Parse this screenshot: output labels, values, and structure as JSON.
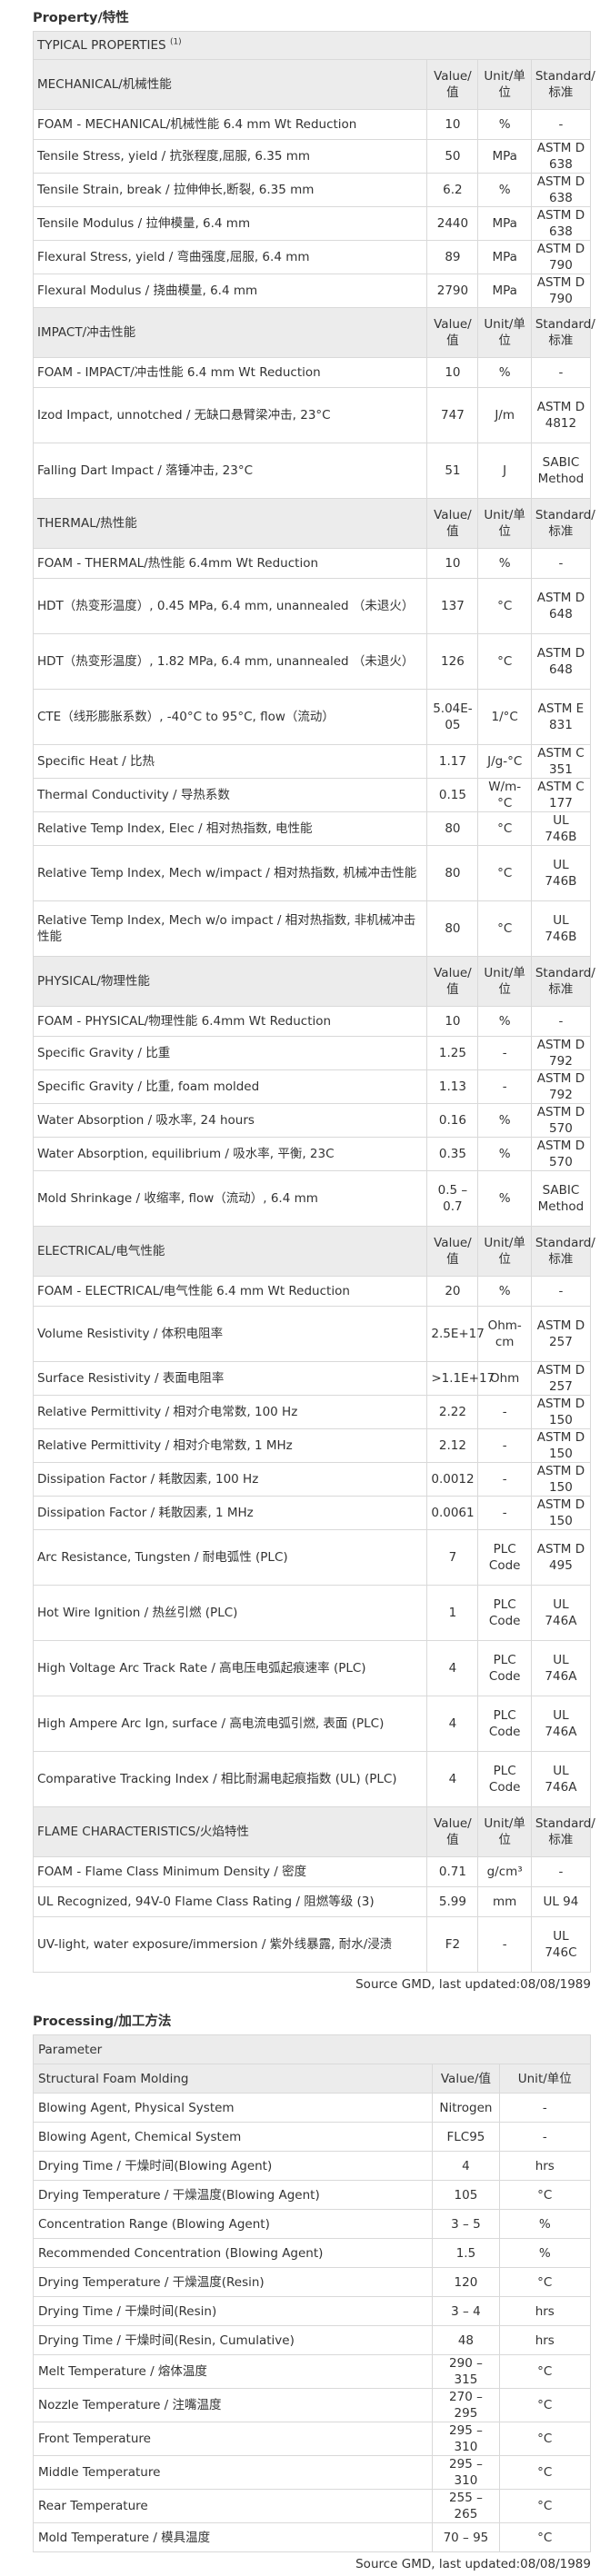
{
  "property": {
    "title": "Property/特性",
    "typical_header": "TYPICAL PROPERTIES",
    "typical_sup": "(1)",
    "col_value": "Value/值",
    "col_unit": "Unit/单位",
    "col_standard": "Standard/标准",
    "groups": [
      {
        "name": "MECHANICAL/机械性能",
        "rows": [
          {
            "name": "FOAM - MECHANICAL/机械性能 6.4 mm Wt Reduction",
            "value": "10",
            "unit": "%",
            "standard": "-"
          },
          {
            "name": "Tensile Stress, yield / 抗张程度,屈服, 6.35 mm",
            "value": "50",
            "unit": "MPa",
            "standard": "ASTM D 638"
          },
          {
            "name": "Tensile Strain, break / 拉伸伸长,断裂, 6.35 mm",
            "value": "6.2",
            "unit": "%",
            "standard": "ASTM D 638"
          },
          {
            "name": "Tensile Modulus / 拉伸模量, 6.4 mm",
            "value": "2440",
            "unit": "MPa",
            "standard": "ASTM D 638"
          },
          {
            "name": "Flexural Stress, yield / 弯曲强度,屈服, 6.4 mm",
            "value": "89",
            "unit": "MPa",
            "standard": "ASTM D 790"
          },
          {
            "name": "Flexural Modulus / 挠曲模量, 6.4 mm",
            "value": "2790",
            "unit": "MPa",
            "standard": "ASTM D 790"
          }
        ]
      },
      {
        "name": "IMPACT/冲击性能",
        "rows": [
          {
            "name": "FOAM - IMPACT/冲击性能 6.4 mm Wt Reduction",
            "value": "10",
            "unit": "%",
            "standard": "-"
          },
          {
            "name": "Izod Impact, unnotched / 无缺口悬臂梁冲击, 23°C",
            "value": "747",
            "unit": "J/m",
            "standard": "ASTM D 4812",
            "tall": true
          },
          {
            "name": "Falling Dart Impact / 落锤冲击, 23°C",
            "value": "51",
            "unit": "J",
            "standard": "SABIC Method",
            "tall": true
          }
        ]
      },
      {
        "name": "THERMAL/热性能",
        "rows": [
          {
            "name": "FOAM - THERMAL/热性能 6.4mm Wt Reduction",
            "value": "10",
            "unit": "%",
            "standard": "-"
          },
          {
            "name": "HDT（热变形温度）, 0.45 MPa, 6.4 mm, unannealed （未退火）",
            "value": "137",
            "unit": "°C",
            "standard": "ASTM D 648",
            "tall": true
          },
          {
            "name": "HDT（热变形温度）, 1.82 MPa, 6.4 mm, unannealed （未退火）",
            "value": "126",
            "unit": "°C",
            "standard": "ASTM D 648",
            "tall": true
          },
          {
            "name": "CTE（线形膨胀系数）, -40°C to 95°C, flow（流动）",
            "value": "5.04E-05",
            "unit": "1/°C",
            "standard": "ASTM E 831",
            "tall": true
          },
          {
            "name": "Specific Heat / 比热",
            "value": "1.17",
            "unit": "J/g-°C",
            "standard": "ASTM C 351"
          },
          {
            "name": "Thermal Conductivity / 导热系数",
            "value": "0.15",
            "unit": "W/m-°C",
            "standard": "ASTM C 177"
          },
          {
            "name": "Relative Temp Index, Elec / 相对热指数, 电性能",
            "value": "80",
            "unit": "°C",
            "standard": "UL 746B"
          },
          {
            "name": "Relative Temp Index, Mech w/impact / 相对热指数, 机械冲击性能",
            "value": "80",
            "unit": "°C",
            "standard": "UL 746B",
            "tall": true
          },
          {
            "name": "Relative Temp Index, Mech w/o impact / 相对热指数, 非机械冲击性能",
            "value": "80",
            "unit": "°C",
            "standard": "UL 746B",
            "tall": true
          }
        ]
      },
      {
        "name": "PHYSICAL/物理性能",
        "rows": [
          {
            "name": "FOAM - PHYSICAL/物理性能 6.4mm Wt Reduction",
            "value": "10",
            "unit": "%",
            "standard": "-"
          },
          {
            "name": "Specific Gravity / 比重",
            "value": "1.25",
            "unit": "-",
            "standard": "ASTM D 792"
          },
          {
            "name": "Specific Gravity / 比重, foam molded",
            "value": "1.13",
            "unit": "-",
            "standard": "ASTM D 792"
          },
          {
            "name": "Water Absorption / 吸水率, 24 hours",
            "value": "0.16",
            "unit": "%",
            "standard": "ASTM D 570"
          },
          {
            "name": "Water Absorption, equilibrium / 吸水率, 平衡, 23C",
            "value": "0.35",
            "unit": "%",
            "standard": "ASTM D 570"
          },
          {
            "name": "Mold Shrinkage / 收缩率, flow（流动）, 6.4 mm",
            "value": "0.5 – 0.7",
            "unit": "%",
            "standard": "SABIC Method",
            "tall": true
          }
        ]
      },
      {
        "name": "ELECTRICAL/电气性能",
        "rows": [
          {
            "name": "FOAM - ELECTRICAL/电气性能 6.4 mm Wt Reduction",
            "value": "20",
            "unit": "%",
            "standard": "-"
          },
          {
            "name": "Volume Resistivity / 体积电阻率",
            "value": "2.5E+17",
            "unit": "Ohm-cm",
            "standard": "ASTM D 257",
            "tall": true
          },
          {
            "name": "Surface Resistivity / 表面电阻率",
            "value": ">1.1E+17",
            "unit": "Ohm",
            "standard": "ASTM D 257"
          },
          {
            "name": "Relative Permittivity / 相对介电常数, 100 Hz",
            "value": "2.22",
            "unit": "-",
            "standard": "ASTM D 150"
          },
          {
            "name": "Relative Permittivity / 相对介电常数, 1 MHz",
            "value": "2.12",
            "unit": "-",
            "standard": "ASTM D 150"
          },
          {
            "name": "Dissipation Factor / 耗散因素, 100 Hz",
            "value": "0.0012",
            "unit": "-",
            "standard": "ASTM D 150"
          },
          {
            "name": "Dissipation Factor / 耗散因素, 1 MHz",
            "value": "0.0061",
            "unit": "-",
            "standard": "ASTM D 150"
          },
          {
            "name": "Arc Resistance, Tungsten / 耐电弧性 (PLC)",
            "value": "7",
            "unit": "PLC Code",
            "standard": "ASTM D 495",
            "tall": true
          },
          {
            "name": "Hot Wire Ignition / 热丝引燃 (PLC)",
            "value": "1",
            "unit": "PLC Code",
            "standard": "UL 746A",
            "tall": true
          },
          {
            "name": "High Voltage Arc Track Rate / 高电压电弧起痕速率 (PLC)",
            "value": "4",
            "unit": "PLC Code",
            "standard": "UL 746A",
            "tall": true
          },
          {
            "name": "High Ampere Arc Ign, surface / 高电流电弧引燃, 表面 (PLC)",
            "value": "4",
            "unit": "PLC Code",
            "standard": "UL 746A",
            "tall": true
          },
          {
            "name": "Comparative Tracking Index / 相比耐漏电起痕指数 (UL) (PLC)",
            "value": "4",
            "unit": "PLC Code",
            "standard": "UL 746A",
            "tall": true
          }
        ]
      },
      {
        "name": "FLAME CHARACTERISTICS/火焰特性",
        "rows": [
          {
            "name": "FOAM - Flame Class Minimum Density / 密度",
            "value": "0.71",
            "unit": "g/cm³",
            "standard": "-"
          },
          {
            "name": "UL Recognized, 94V-0 Flame Class Rating / 阻燃等级 (3)",
            "value": "5.99",
            "unit": "mm",
            "standard": "UL 94"
          },
          {
            "name": "UV-light, water exposure/immersion / 紫外线暴露, 耐水/浸渍",
            "value": "F2",
            "unit": "-",
            "standard": "UL 746C",
            "tall": true
          }
        ]
      }
    ],
    "source": "Source GMD, last updated:08/08/1989"
  },
  "processing": {
    "title": "Processing/加工方法",
    "param_header": "Parameter",
    "method": "Structural Foam Molding",
    "col_value": "Value/值",
    "col_unit": "Unit/单位",
    "rows": [
      {
        "name": "Blowing Agent, Physical System",
        "value": "Nitrogen",
        "unit": "-"
      },
      {
        "name": "Blowing Agent, Chemical System",
        "value": "FLC95",
        "unit": "-"
      },
      {
        "name": "Drying Time / 干燥时间(Blowing Agent)",
        "value": "4",
        "unit": "hrs"
      },
      {
        "name": "Drying Temperature / 干燥温度(Blowing Agent)",
        "value": "105",
        "unit": "°C"
      },
      {
        "name": "Concentration Range (Blowing Agent)",
        "value": "3 – 5",
        "unit": "%"
      },
      {
        "name": "Recommended Concentration (Blowing Agent)",
        "value": "1.5",
        "unit": "%"
      },
      {
        "name": "Drying Temperature / 干燥温度(Resin)",
        "value": "120",
        "unit": "°C"
      },
      {
        "name": "Drying Time / 干燥时间(Resin)",
        "value": "3 – 4",
        "unit": "hrs"
      },
      {
        "name": "Drying Time / 干燥时间(Resin, Cumulative)",
        "value": "48",
        "unit": "hrs"
      },
      {
        "name": "Melt Temperature / 熔体温度",
        "value": "290 – 315",
        "unit": "°C"
      },
      {
        "name": "Nozzle Temperature / 注嘴温度",
        "value": "270 – 295",
        "unit": "°C"
      },
      {
        "name": "Front Temperature",
        "value": "295 – 310",
        "unit": "°C"
      },
      {
        "name": "Middle Temperature",
        "value": "295 – 310",
        "unit": "°C"
      },
      {
        "name": "Rear Temperature",
        "value": "255 – 265",
        "unit": "°C"
      },
      {
        "name": "Mold Temperature / 模具温度",
        "value": "70 – 95",
        "unit": "°C"
      }
    ],
    "source": "Source GMD, last updated:08/08/1989"
  }
}
